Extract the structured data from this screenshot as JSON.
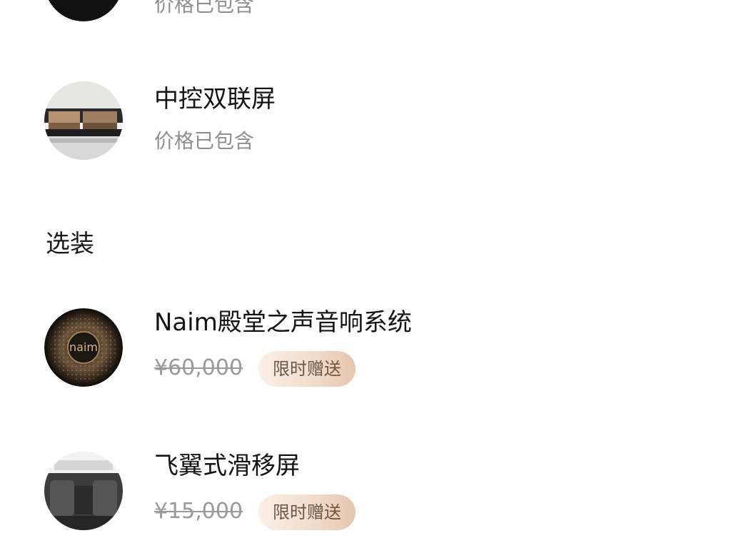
{
  "items_included": [
    {
      "title": "",
      "subtitle": "价格已包含",
      "icon": "dark-feature-icon"
    },
    {
      "title": "中控双联屏",
      "subtitle": "价格已包含",
      "icon": "dual-screen-icon"
    }
  ],
  "optional_section": {
    "label": "选装"
  },
  "items_optional": [
    {
      "title": "Naim殿堂之声音响系统",
      "price": "¥60,000",
      "badge": "限时赠送",
      "icon": "naim-speaker-icon",
      "brand_text": "naim"
    },
    {
      "title": "飞翼式滑移屏",
      "price": "¥15,000",
      "badge": "限时赠送",
      "icon": "sliding-screen-icon"
    }
  ],
  "colors": {
    "subtext": "#8f8f8f",
    "badge_text": "#6d5646",
    "badge_from": "#fbf0e7",
    "badge_to": "#e6c6ae"
  }
}
